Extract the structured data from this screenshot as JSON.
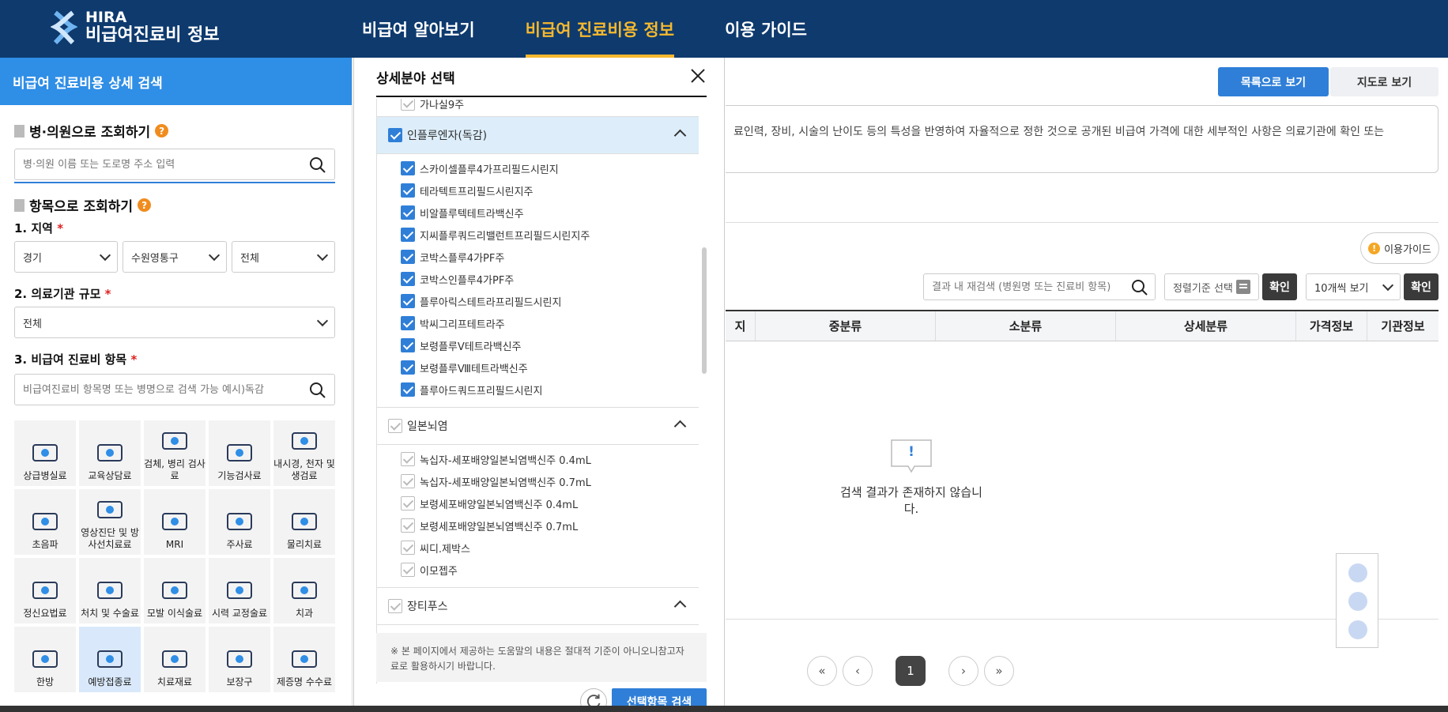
{
  "header": {
    "logo_line1": "HIRA",
    "logo_line2": "비급여진료비 정보",
    "nav": [
      {
        "label": "비급여 알아보기",
        "active": false
      },
      {
        "label": "비급여 진료비용 정보",
        "active": true
      },
      {
        "label": "이용 가이드",
        "active": false
      }
    ],
    "bg_color": "#0e3a6e",
    "accent_color": "#f5b82e"
  },
  "sidebar": {
    "title": "비급여 진료비용 상세 검색",
    "hospital_search": {
      "heading": "병·의원으로 조회하기",
      "placeholder": "병·의원 이름 또는 도로명 주소 입력"
    },
    "item_search": {
      "heading": "항목으로 조회하기",
      "region_label": "1. 지역",
      "region_values": [
        "경기",
        "수원영통구",
        "전체"
      ],
      "scale_label": "2. 의료기관 규모",
      "scale_value": "전체",
      "item_label": "3. 비급여 진료비 항목",
      "item_placeholder": "비급여진료비 항목명 또는 병명으로 검색 가능 예시)독감",
      "required_mark": "*",
      "help_mark": "?"
    },
    "categories": [
      {
        "label": "상급병실료",
        "icon": "hospital-bed-icon"
      },
      {
        "label": "교육상담료",
        "icon": "consultation-icon"
      },
      {
        "label": "검체, 병리 검사료",
        "icon": "specimen-test-icon"
      },
      {
        "label": "기능검사료",
        "icon": "function-test-icon"
      },
      {
        "label": "내시경, 천자 및 생검료",
        "icon": "endoscope-icon"
      },
      {
        "label": "초음파",
        "icon": "ultrasound-icon"
      },
      {
        "label": "영상진단 및 방사선치료료",
        "icon": "radiology-icon"
      },
      {
        "label": "MRI",
        "icon": "mri-icon"
      },
      {
        "label": "주사료",
        "icon": "syringe-icon"
      },
      {
        "label": "물리치료",
        "icon": "physical-therapy-icon"
      },
      {
        "label": "정신요법료",
        "icon": "brain-icon"
      },
      {
        "label": "처치 및 수술료",
        "icon": "surgery-icon"
      },
      {
        "label": "모발 이식술료",
        "icon": "hair-transplant-icon"
      },
      {
        "label": "시력 교정술료",
        "icon": "eye-icon"
      },
      {
        "label": "치과",
        "icon": "tooth-icon"
      },
      {
        "label": "한방",
        "icon": "acupuncture-icon"
      },
      {
        "label": "예방접종료",
        "icon": "vaccination-icon",
        "selected": true
      },
      {
        "label": "치료재료",
        "icon": "material-icon"
      },
      {
        "label": "보장구",
        "icon": "wheelchair-icon"
      },
      {
        "label": "제증명 수수료",
        "icon": "certificate-icon"
      }
    ],
    "accent_color": "#2f8ee6"
  },
  "modal": {
    "title": "상세분야 선택",
    "partial_item": "가나실9주",
    "groups": [
      {
        "name": "인플루엔자(독감)",
        "checked": true,
        "items": [
          "스카이셀플루4가프리필드시린지",
          "테라텍트프리필드시린지주",
          "비알플루텍테트라백신주",
          "지씨플루쿼드리밸런트프리필드시린지주",
          "코박스플루4가PF주",
          "코박스인플루4가PF주",
          "플루아릭스테트라프리필드시린지",
          "박씨그리프테트라주",
          "보령플루Ⅴ테트라백신주",
          "보령플루Ⅷ테트라백신주",
          "플루아드쿼드프리필드시린지"
        ]
      },
      {
        "name": "일본뇌염",
        "checked": false,
        "items": [
          "녹십자-세포배양일본뇌염백신주 0.4mL",
          "녹십자-세포배양일본뇌염백신주 0.7mL",
          "보령세포배양일본뇌염백신주 0.4mL",
          "보령세포배양일본뇌염백신주 0.7mL",
          "씨디.제박스",
          "이모젭주"
        ]
      },
      {
        "name": "장티푸스",
        "checked": false,
        "items": []
      }
    ],
    "notice": "※ 본 페이지에서 제공하는 도움말의 내용은 절대적 기준이 아니오니참고자료로 활용하시기 바랍니다.",
    "apply_label": "선택항목 검색",
    "check_color": "#2f7fd8"
  },
  "main": {
    "view_list_label": "목록으로 보기",
    "view_map_label": "지도로 보기",
    "info_text": "료인력, 장비, 시술의 난이도 등의 특성을 반영하여 자율적으로 정한 것으로 공개된 비급여 가격에 대한 세부적인 사항은 의료기관에 확인 또는",
    "guide_label": "이용가이드",
    "guide_mark": "!",
    "re_search_placeholder": "결과 내 재검색 (병원명 또는 진료비 항목)",
    "sort_label": "정렬기준 선택",
    "confirm_label": "확인",
    "per_page_label": "10개씩 보기",
    "columns": [
      "지",
      "중분류",
      "소분류",
      "상세분류",
      "가격정보",
      "기관정보"
    ],
    "empty_mark": "!",
    "empty_text": "검색 결과가 존재하지 않습니다.",
    "pagination": {
      "first": "«",
      "prev": "‹",
      "current": "1",
      "next": "›",
      "last": "»"
    }
  }
}
